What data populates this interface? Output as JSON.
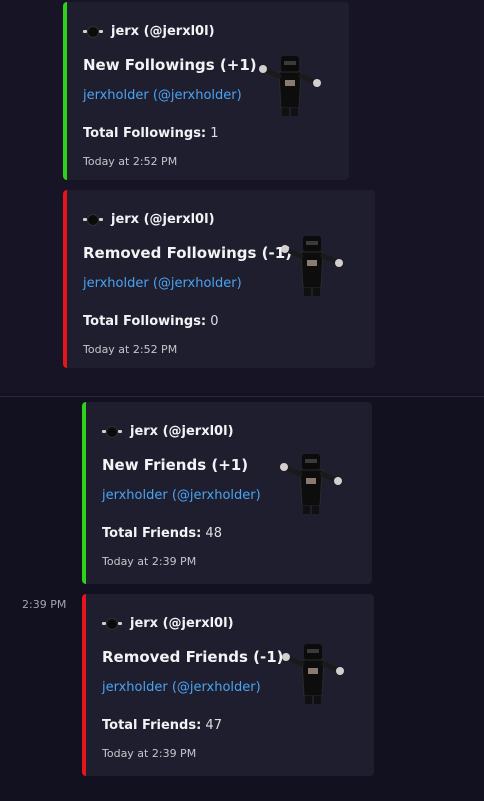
{
  "side_timestamp": "2:39 PM",
  "embeds": [
    {
      "author": "jerx (@jerxl0l)",
      "title": "New Followings (+1)",
      "description": "jerxholder (@jerxholder)",
      "field_label": "Total Followings:",
      "field_value": "1",
      "footer": "Today at 2:52 PM",
      "accent": "#2fd11c"
    },
    {
      "author": "jerx (@jerxl0l)",
      "title": "Removed Followings (-1)",
      "description": "jerxholder (@jerxholder)",
      "field_label": "Total Followings:",
      "field_value": "0",
      "footer": "Today at 2:52 PM",
      "accent": "#e5151b"
    },
    {
      "author": "jerx (@jerxl0l)",
      "title": "New Friends (+1)",
      "description": "jerxholder (@jerxholder)",
      "field_label": "Total Friends:",
      "field_value": "48",
      "footer": "Today at 2:39 PM",
      "accent": "#2fd11c"
    },
    {
      "author": "jerx (@jerxl0l)",
      "title": "Removed Friends (-1)",
      "description": "jerxholder (@jerxholder)",
      "field_label": "Total Friends:",
      "field_value": "47",
      "footer": "Today at 2:39 PM",
      "accent": "#e5151b"
    }
  ]
}
